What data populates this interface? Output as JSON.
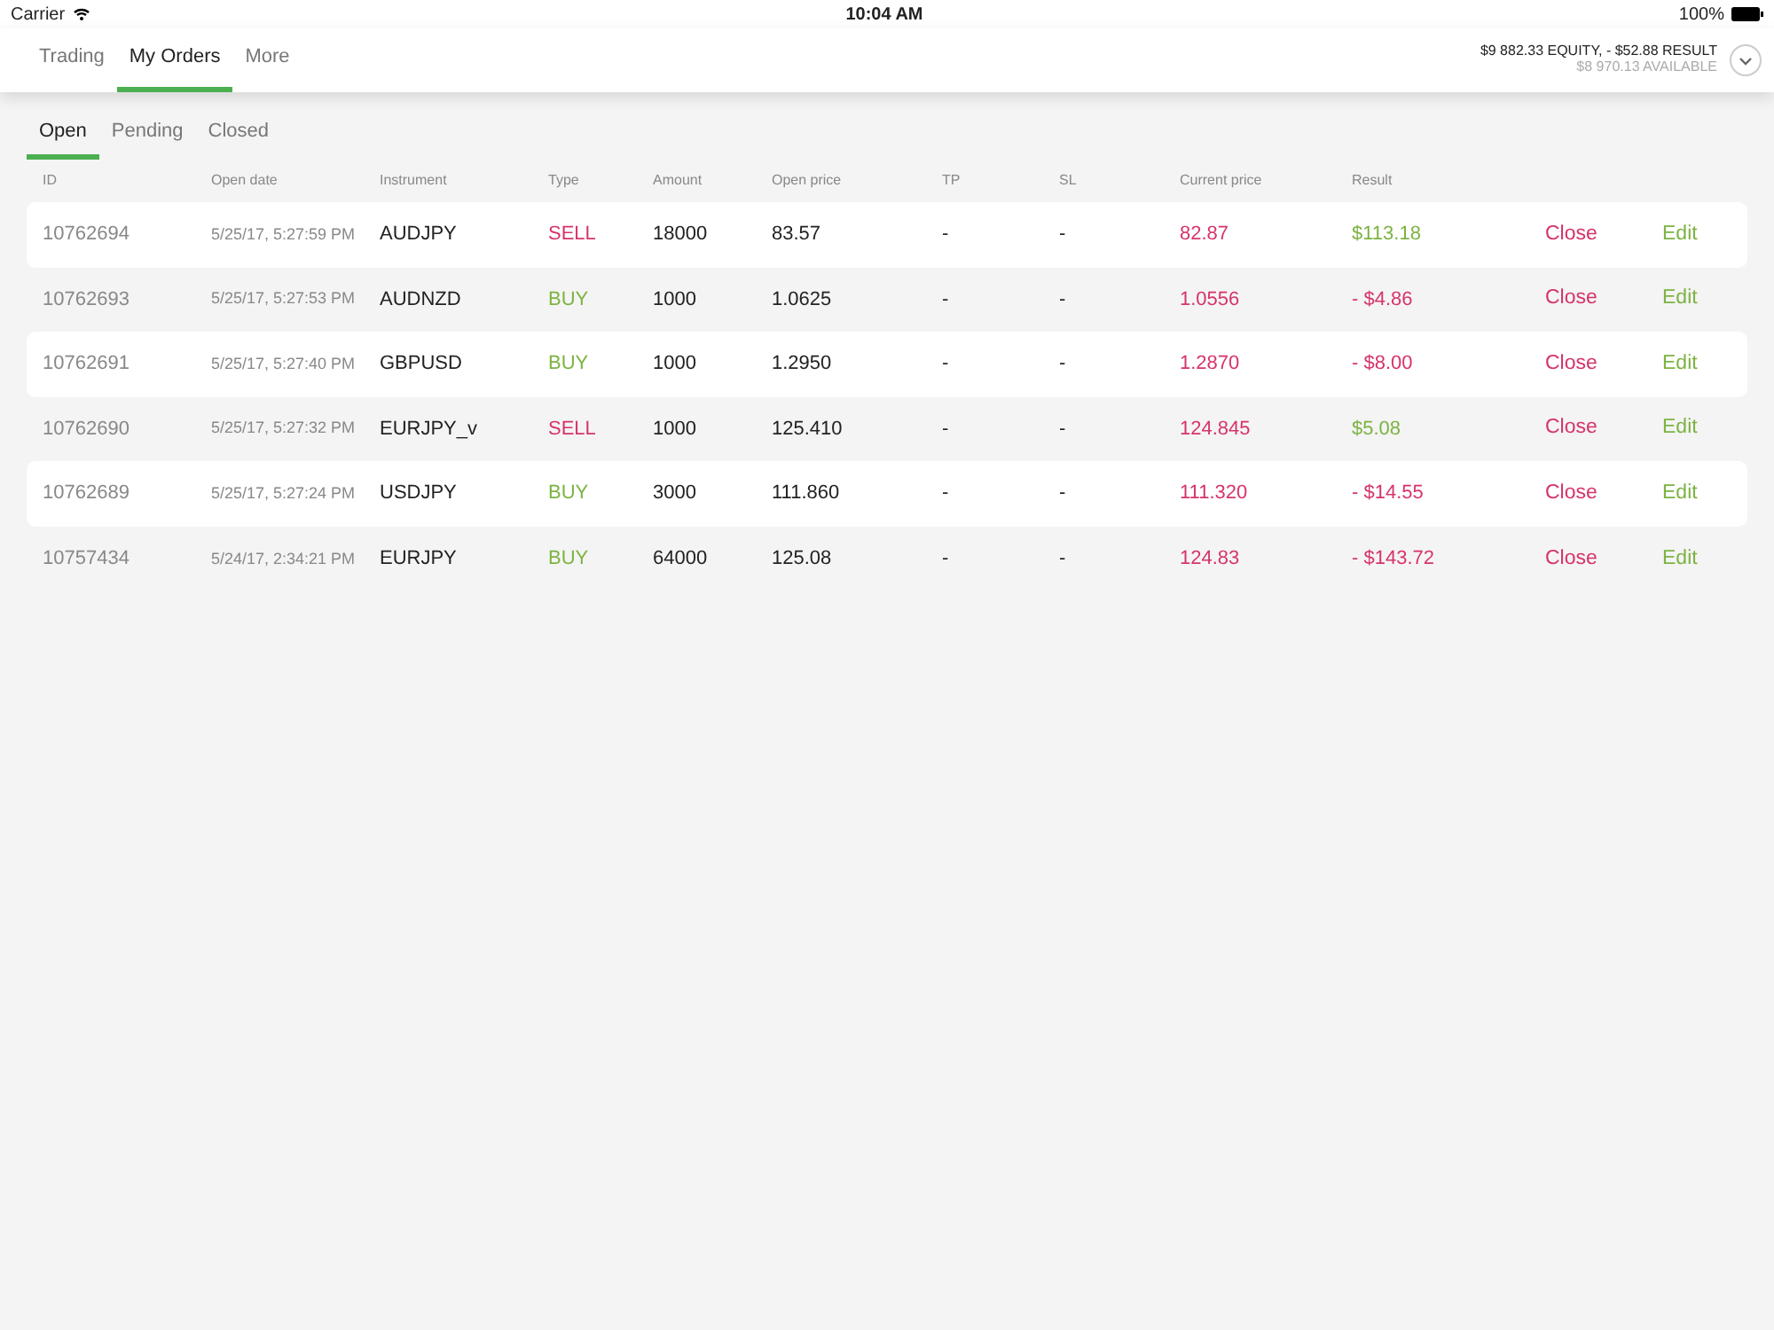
{
  "status_bar": {
    "carrier": "Carrier",
    "time": "10:04 AM",
    "battery": "100%"
  },
  "main_tabs": [
    {
      "label": "Trading",
      "selected": false
    },
    {
      "label": "My Orders",
      "selected": true
    },
    {
      "label": "More",
      "selected": false
    }
  ],
  "account": {
    "equity": "$9 882.33 EQUITY, - $52.88 RESULT",
    "available": "$8 970.13 AVAILABLE"
  },
  "sub_tabs": [
    {
      "label": "Open",
      "selected": true
    },
    {
      "label": "Pending",
      "selected": false
    },
    {
      "label": "Closed",
      "selected": false
    }
  ],
  "table": {
    "columns": [
      "ID",
      "Open date",
      "Instrument",
      "Type",
      "Amount",
      "Open price",
      "TP",
      "SL",
      "Current price",
      "Result"
    ],
    "rows": [
      {
        "id": "10762694",
        "open_date": "5/25/17, 5:27:59 PM",
        "instrument": "AUDJPY",
        "type": {
          "text": "SELL",
          "kind": "sell"
        },
        "amount": "18000",
        "open_price": "83.57",
        "tp": "-",
        "sl": "-",
        "current_price": "82.87",
        "result": {
          "text": "$113.18",
          "kind": "gain"
        },
        "close": "Close",
        "edit": "Edit"
      },
      {
        "id": "10762693",
        "open_date": "5/25/17, 5:27:53 PM",
        "instrument": "AUDNZD",
        "type": {
          "text": "BUY",
          "kind": "buy"
        },
        "amount": "1000",
        "open_price": "1.0625",
        "tp": "-",
        "sl": "-",
        "current_price": "1.0556",
        "result": {
          "text": "- $4.86",
          "kind": "loss"
        },
        "close": "Close",
        "edit": "Edit"
      },
      {
        "id": "10762691",
        "open_date": "5/25/17, 5:27:40 PM",
        "instrument": "GBPUSD",
        "type": {
          "text": "BUY",
          "kind": "buy"
        },
        "amount": "1000",
        "open_price": "1.2950",
        "tp": "-",
        "sl": "-",
        "current_price": "1.2870",
        "result": {
          "text": "- $8.00",
          "kind": "loss"
        },
        "close": "Close",
        "edit": "Edit"
      },
      {
        "id": "10762690",
        "open_date": "5/25/17, 5:27:32 PM",
        "instrument": "EURJPY_v",
        "type": {
          "text": "SELL",
          "kind": "sell"
        },
        "amount": "1000",
        "open_price": "125.410",
        "tp": "-",
        "sl": "-",
        "current_price": "124.845",
        "result": {
          "text": "$5.08",
          "kind": "gain"
        },
        "close": "Close",
        "edit": "Edit"
      },
      {
        "id": "10762689",
        "open_date": "5/25/17, 5:27:24 PM",
        "instrument": "USDJPY",
        "type": {
          "text": "BUY",
          "kind": "buy"
        },
        "amount": "3000",
        "open_price": "111.860",
        "tp": "-",
        "sl": "-",
        "current_price": "111.320",
        "result": {
          "text": "- $14.55",
          "kind": "loss"
        },
        "close": "Close",
        "edit": "Edit"
      },
      {
        "id": "10757434",
        "open_date": "5/24/17, 2:34:21 PM",
        "instrument": "EURJPY",
        "type": {
          "text": "BUY",
          "kind": "buy"
        },
        "amount": "64000",
        "open_price": "125.08",
        "tp": "-",
        "sl": "-",
        "current_price": "124.83",
        "result": {
          "text": "- $143.72",
          "kind": "loss"
        },
        "close": "Close",
        "edit": "Edit"
      }
    ]
  }
}
